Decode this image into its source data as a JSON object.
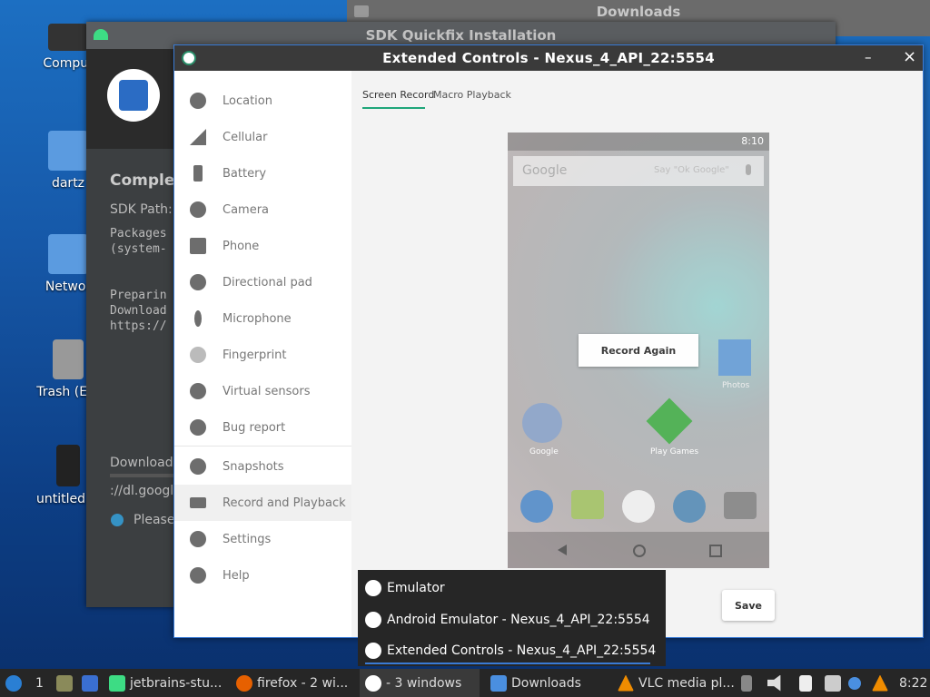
{
  "desktop": {
    "icons": [
      {
        "label": "Comput",
        "icon": "computer-icon"
      },
      {
        "label": "dartz",
        "icon": "home-folder-icon"
      },
      {
        "label": "Networ",
        "icon": "network-folder-icon"
      },
      {
        "label": "Trash (Em",
        "icon": "trash-icon"
      },
      {
        "label": "untitled.w",
        "icon": "file-icon"
      }
    ]
  },
  "downloads_window": {
    "title": "Downloads"
  },
  "sdk_window": {
    "title": "SDK Quickfix Installation",
    "heading": "Complet",
    "sdk_path_label": "SDK Path:",
    "log_lines": [
      "Packages",
      "(system-",
      "",
      "Preparin",
      "Download",
      "https://"
    ],
    "downloading_label": "Downloadi",
    "url_fragment": "://dl.google",
    "please_text": "Please"
  },
  "extended_controls": {
    "title": "Extended Controls - Nexus_4_API_22:5554",
    "minimize": "–",
    "close": "×",
    "nav": [
      {
        "label": "Location",
        "icon": "location-pin-icon"
      },
      {
        "label": "Cellular",
        "icon": "signal-icon"
      },
      {
        "label": "Battery",
        "icon": "battery-icon"
      },
      {
        "label": "Camera",
        "icon": "camera-aperture-icon"
      },
      {
        "label": "Phone",
        "icon": "phone-icon"
      },
      {
        "label": "Directional pad",
        "icon": "dpad-icon"
      },
      {
        "label": "Microphone",
        "icon": "microphone-icon"
      },
      {
        "label": "Fingerprint",
        "icon": "fingerprint-icon"
      },
      {
        "label": "Virtual sensors",
        "icon": "sensors-icon"
      },
      {
        "label": "Bug report",
        "icon": "bug-icon"
      },
      {
        "label": "Snapshots",
        "icon": "history-icon"
      },
      {
        "label": "Record and Playback",
        "icon": "video-camera-icon"
      },
      {
        "label": "Settings",
        "icon": "gear-icon"
      },
      {
        "label": "Help",
        "icon": "help-icon"
      }
    ],
    "selected_nav": "Record and Playback",
    "tabs": [
      "Screen Record",
      "Macro Playback"
    ],
    "active_tab": "Screen Record",
    "phone": {
      "status_time": "8:10",
      "search_brand": "Google",
      "search_hint": "Say \"Ok Google\"",
      "record_again": "Record Again",
      "apps": [
        "Google",
        "Play Games",
        "Photos"
      ]
    },
    "save_label": "Save"
  },
  "popup": {
    "items": [
      "Emulator",
      "Android Emulator - Nexus_4_API_22:5554",
      "Extended Controls - Nexus_4_API_22:5554"
    ]
  },
  "taskbar": {
    "workspace": "1",
    "items": [
      {
        "label": "jetbrains-stu...",
        "icon": "android-icon"
      },
      {
        "label": "firefox - 2 wi...",
        "icon": "firefox-icon"
      },
      {
        "label": "- 3 windows",
        "icon": "emulator-icon"
      },
      {
        "label": "Downloads",
        "icon": "folder-icon"
      },
      {
        "label": "VLC media pl...",
        "icon": "vlc-icon"
      }
    ],
    "clock": "8:22"
  }
}
